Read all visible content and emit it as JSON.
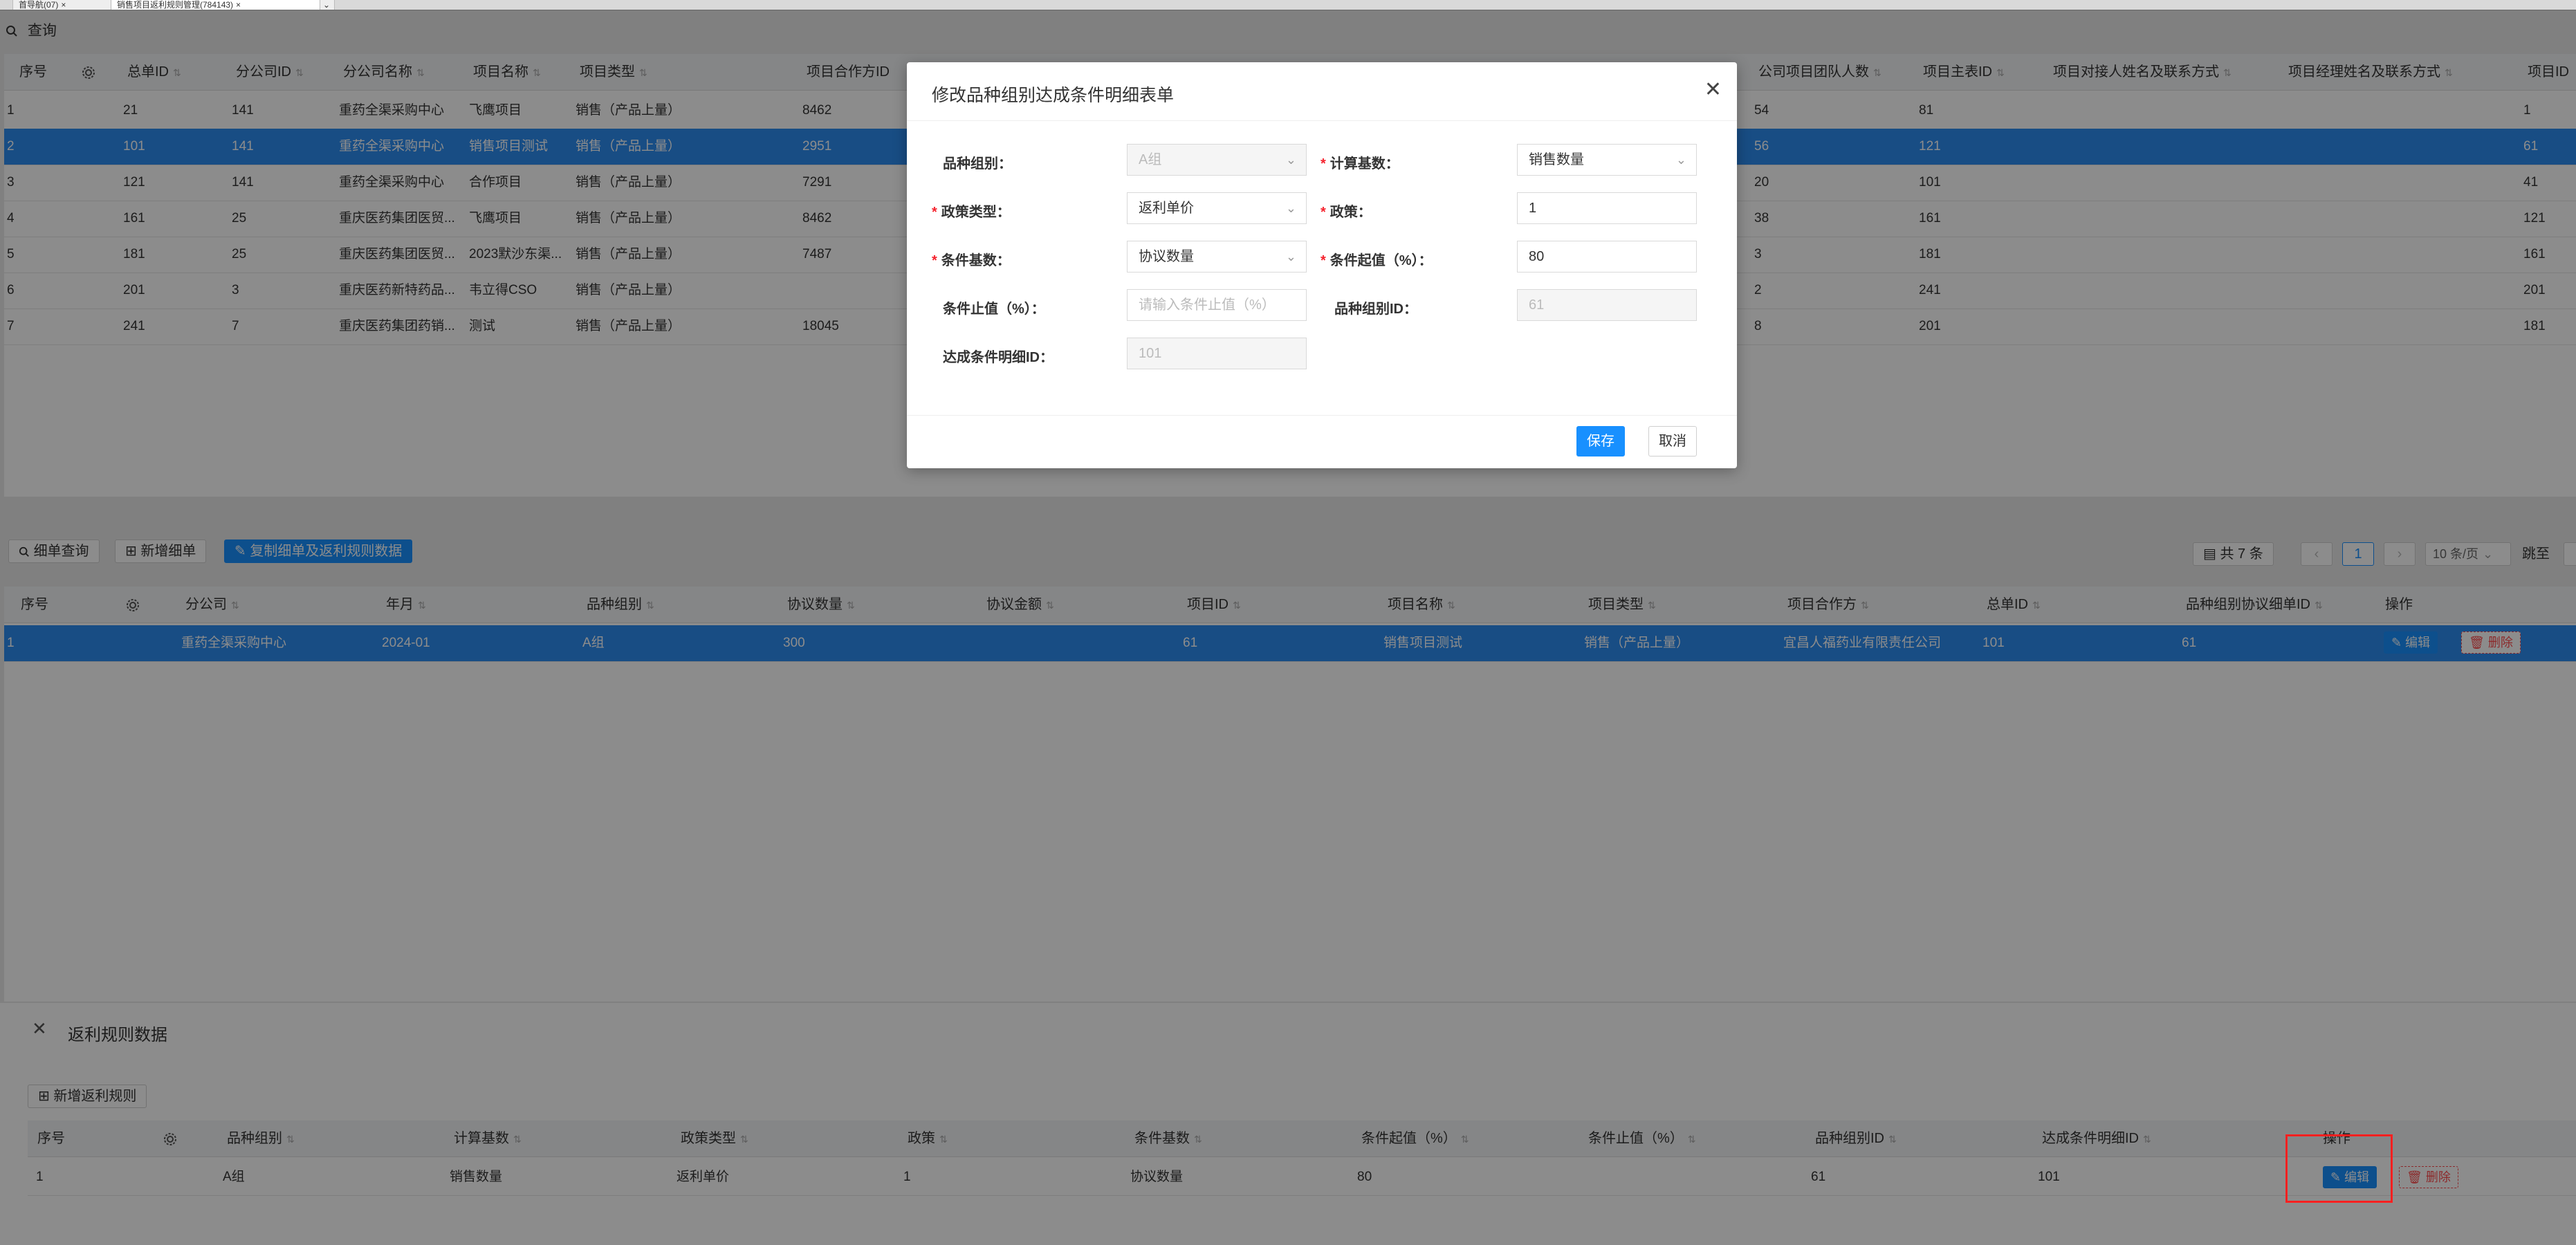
{
  "tabs": [
    {
      "label": "首导航(07)",
      "close": "×"
    },
    {
      "label": "销售项目返利规则管理(784143)",
      "close": "×"
    }
  ],
  "toolbar": {
    "query": "查询"
  },
  "top_grid": {
    "headers": [
      "序号",
      "",
      "总单ID",
      "分公司ID",
      "分公司名称",
      "项目名称",
      "项目类型",
      "项目合作方ID",
      "",
      "公司项目团队人数",
      "项目主表ID",
      "项目对接人姓名及联系方式",
      "项目经理姓名及联系方式",
      "项目ID"
    ],
    "rows": [
      [
        "1",
        "",
        "21",
        "141",
        "重药全渠采购中心",
        "飞鹰项目",
        "销售（产品上量）",
        "8462",
        "",
        "54",
        "81",
        "",
        "",
        "1"
      ],
      [
        "2",
        "",
        "101",
        "141",
        "重药全渠采购中心",
        "销售项目测试",
        "销售（产品上量）",
        "2951",
        "",
        "56",
        "121",
        "",
        "",
        "61"
      ],
      [
        "3",
        "",
        "121",
        "141",
        "重药全渠采购中心",
        "合作项目",
        "销售（产品上量）",
        "7291",
        "",
        "20",
        "101",
        "",
        "",
        "41"
      ],
      [
        "4",
        "",
        "161",
        "25",
        "重庆医药集团医贸...",
        "飞鹰项目",
        "销售（产品上量）",
        "8462",
        "",
        "38",
        "161",
        "",
        "",
        "121"
      ],
      [
        "5",
        "",
        "181",
        "25",
        "重庆医药集团医贸...",
        "2023默沙东渠...",
        "销售（产品上量）",
        "7487",
        "",
        "3",
        "181",
        "",
        "",
        "161"
      ],
      [
        "6",
        "",
        "201",
        "3",
        "重庆医药新特药品...",
        "韦立得CSO",
        "销售（产品上量）",
        "",
        "",
        "2",
        "241",
        "",
        "",
        "201"
      ],
      [
        "7",
        "",
        "241",
        "7",
        "重庆医药集团药销...",
        "测试",
        "销售（产品上量）",
        "18045",
        "",
        "8",
        "201",
        "",
        "",
        "181"
      ]
    ]
  },
  "detail_toolbar": {
    "query": "细单查询",
    "add": "新增细单",
    "copy": "复制细单及返利规则数据",
    "total": "共 7 条",
    "page": "1",
    "page_size": "10 条/页",
    "jump": "跳至"
  },
  "detail_grid": {
    "headers": [
      "序号",
      "",
      "分公司",
      "年月",
      "品种组别",
      "协议数量",
      "协议金额",
      "项目ID",
      "项目名称",
      "项目类型",
      "项目合作方",
      "总单ID",
      "品种组别协议细单ID",
      "操作"
    ],
    "rows": [
      [
        "1",
        "",
        "重药全渠采购中心",
        "2024-01",
        "A组",
        "300",
        "",
        "61",
        "销售项目测试",
        "销售（产品上量）",
        "宜昌人福药业有限责任公司",
        "101",
        "61",
        ""
      ]
    ],
    "edit": "编辑",
    "delete": "删除"
  },
  "modal": {
    "title": "修改品种组别达成条件明细表单",
    "fields": {
      "variety_group_label": "品种组别：",
      "variety_group_value": "A组",
      "calc_base_label": "计算基数：",
      "calc_base_value": "销售数量",
      "policy_type_label": "政策类型：",
      "policy_type_value": "返利单价",
      "policy_label": "政策：",
      "policy_value": "1",
      "cond_base_label": "条件基数：",
      "cond_base_value": "协议数量",
      "cond_start_label": "条件起值（%）：",
      "cond_start_value": "80",
      "cond_end_label": "条件止值（%）：",
      "cond_end_placeholder": "请输入条件止值（%）",
      "group_id_label": "品种组别ID：",
      "group_id_value": "61",
      "detail_id_label": "达成条件明细ID：",
      "detail_id_value": "101"
    },
    "save": "保存",
    "cancel": "取消"
  },
  "drawer": {
    "title": "返利规则数据",
    "add": "新增返利规则",
    "headers": [
      "序号",
      "",
      "品种组别",
      "计算基数",
      "政策类型",
      "政策",
      "条件基数",
      "条件起值（%）",
      "条件止值（%）",
      "品种组别ID",
      "达成条件明细ID",
      "操作"
    ],
    "rows": [
      [
        "1",
        "",
        "A组",
        "销售数量",
        "返利单价",
        "1",
        "协议数量",
        "80",
        "",
        "61",
        "101",
        ""
      ]
    ],
    "edit": "编辑",
    "delete": "删除"
  },
  "colors": {
    "primary": "#1890ff",
    "selected_row": "#2d8cf0",
    "danger": "#ff4d4f",
    "highlight_box": "#ff2020"
  }
}
